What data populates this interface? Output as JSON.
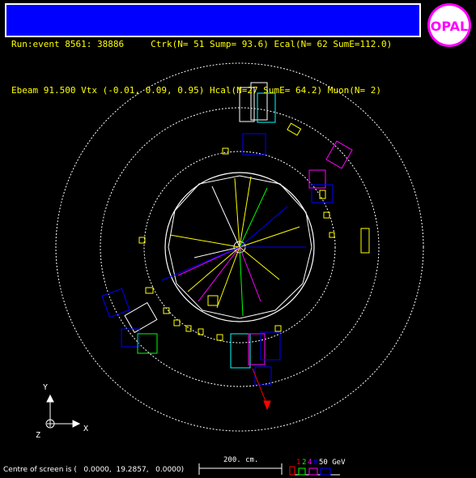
{
  "header": {
    "line1": "Run:event 8561: 38886     Ctrk(N= 51 Sump= 93.6) Ecal(N= 62 SumE=112.0)",
    "line2": "Ebeam 91.500 Vtx (-0.01, 0.09, 0.95) Hcal(N=27 SumE= 64.2) Muon(N= 2)"
  },
  "axes": {
    "y_label": "Y",
    "x_label": "X",
    "z_label": "Z"
  },
  "scale_bar": {
    "label": "200. cm."
  },
  "energy_legend": {
    "values": [
      "1",
      "2",
      "4",
      "8",
      "50 GeV"
    ],
    "colors": [
      "#ff0000",
      "#00ff00",
      "#ff00ff",
      "#0000ff",
      "#ffffff"
    ]
  },
  "footer": {
    "centre_text": "Centre of screen is (   0.0000,  19.2857,   0.0000)"
  },
  "logo": {
    "text": "OPAL",
    "colors": {
      "ring": "#ff00ff",
      "fill": "#ffffff",
      "letters": "#ff00ff"
    }
  },
  "colors": {
    "header_bg": "#0000ff",
    "header_text": "#ffff00",
    "background": "#000000"
  }
}
